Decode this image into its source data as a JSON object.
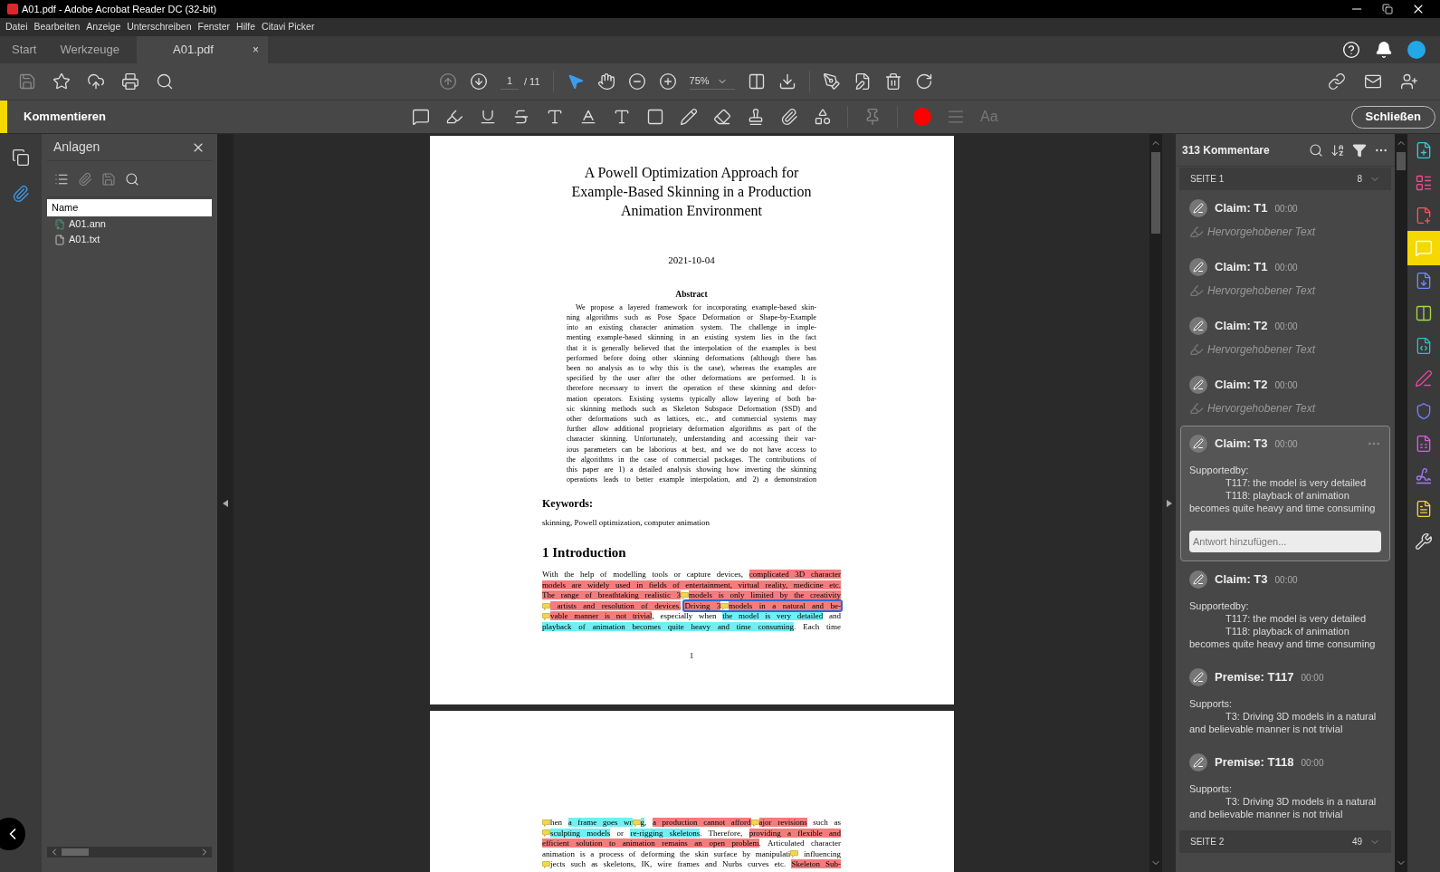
{
  "window": {
    "title": "A01.pdf - Adobe Acrobat Reader DC (32-bit)"
  },
  "menu": [
    "Datei",
    "Bearbeiten",
    "Anzeige",
    "Unterschreiben",
    "Fenster",
    "Hilfe",
    "Citavi Picker"
  ],
  "tabs": [
    {
      "label": "Start",
      "selected": false
    },
    {
      "label": "Werkzeuge",
      "selected": false
    },
    {
      "label": "A01.pdf",
      "selected": true,
      "close": "×"
    }
  ],
  "toolbar": {
    "page": "1",
    "page_total": "/ 11",
    "zoom": "75%"
  },
  "comment_bar": {
    "title": "Kommentieren",
    "close": "Schließen",
    "color": "#ff0000",
    "font": "Aa"
  },
  "attachments": {
    "title": "Anlagen",
    "column": "Name",
    "files": [
      {
        "name": "A01.ann",
        "kind": "ann"
      },
      {
        "name": "A01.txt",
        "kind": "txt"
      }
    ]
  },
  "document": {
    "title_lines": [
      "A Powell Optimization Approach for",
      "Example-Based Skinning in a Production",
      "Animation Environment"
    ],
    "date": "2021-10-04",
    "abstract_heading": "Abstract",
    "abstract_lines": [
      "We propose a layered framework for incorporating example-based skin-",
      "ning algorithms such as Pose Space Deformation or Shape-by-Example",
      "into an existing character animation system. The challenge in imple-",
      "menting example-based skinning in an existing system lies in the fact",
      "that it is generally believed that the interpolation of the examples is best",
      "performed before doing other skinning deformations (although there has",
      "been no analysis as to why this is the case), whereas the examples are",
      "specified by the user after the other deformations are performed. It is",
      "therefore necessary to invert the operation of these skinning and defor-",
      "mation operators. Existing systems typically allow layering of both ba-",
      "sic skinning methods such as Skeleton Subspace Deformation (SSD) and",
      "other deformations such as lattices, etc., and commercial systems may",
      "further allow additional proprietary deformation algorithms as part of the",
      "character skinning. Unfortunately, understanding and accessing their var-",
      "ious parameters can be laborious at best, and we do not have access to",
      "the algorithms in the case of commercial packages. The contributions of",
      "this paper are 1) a detailed analysis showing how inverting the skinning",
      "operations leads to better example interpolation, and 2) a demonstration"
    ],
    "keywords_heading": "Keywords:",
    "keywords": "skinning, Powell optimization, computer animation",
    "section": "1 Introduction",
    "intro_lines": [
      [
        {
          "kind": "text",
          "text": "With the help of modelling tools or capture devices, "
        },
        {
          "kind": "text",
          "text": "complicated 3D character",
          "color": "#f47c7c"
        }
      ],
      [
        {
          "kind": "text",
          "text": "models are widely used in fields of entertainment, virtual reality, medicine etc.",
          "color": "#f47c7c"
        }
      ],
      [
        {
          "kind": "text",
          "text": "The range of breathtaking realistic 3",
          "color": "#f47c7c"
        },
        {
          "kind": "note"
        },
        {
          "kind": "text",
          "text": "models is only limited by the creativity",
          "color": "#f47c7c"
        }
      ],
      [
        {
          "kind": "note"
        },
        {
          "kind": "text",
          "text": " artists and resolution of devices.",
          "color": "#f47c7c"
        },
        {
          "kind": "focus",
          "segments": [
            {
              "kind": "text",
              "text": "Driving 3",
              "color": "#f47c7c"
            },
            {
              "kind": "note"
            },
            {
              "kind": "text",
              "text": "models in a natural and be-",
              "color": "#f47c7c"
            }
          ]
        }
      ],
      [
        {
          "kind": "note"
        },
        {
          "kind": "text",
          "text": "vable manner is not trivial",
          "color": "#f47c7c"
        },
        {
          "kind": "text",
          "text": ", especially when "
        },
        {
          "kind": "text",
          "text": "the model is very detailed",
          "color": "#6ff0f2"
        },
        {
          "kind": "text",
          "text": " and"
        }
      ],
      [
        {
          "kind": "text",
          "text": "playback of animation becomes quite heavy and time consuming",
          "color": "#6ff0f2"
        },
        {
          "kind": "text",
          "text": ". Each time"
        }
      ]
    ],
    "page_number": "1",
    "page2_lines": [
      [
        {
          "kind": "note"
        },
        {
          "kind": "text",
          "text": "hen "
        },
        {
          "kind": "text",
          "text": "a frame goes wr",
          "color": "#6ff0f2"
        },
        {
          "kind": "note"
        },
        {
          "kind": "text",
          "text": "g",
          "color": "#6ff0f2"
        },
        {
          "kind": "text",
          "text": ", "
        },
        {
          "kind": "text",
          "text": "a production cannot afford",
          "color": "#f47c7c"
        },
        {
          "kind": "note"
        },
        {
          "kind": "text",
          "text": "ajor revisions",
          "color": "#f47c7c"
        },
        {
          "kind": "text",
          "text": " such as"
        }
      ],
      [
        {
          "kind": "note"
        },
        {
          "kind": "text",
          "text": "sculpting models",
          "color": "#6ff0f2"
        },
        {
          "kind": "text",
          "text": " or "
        },
        {
          "kind": "text",
          "text": "re-rigging skeletons",
          "color": "#6ff0f2"
        },
        {
          "kind": "text",
          "text": ". Therefore, "
        },
        {
          "kind": "text",
          "text": "providing a flexible and",
          "color": "#f47c7c"
        }
      ],
      [
        {
          "kind": "text",
          "text": "efficient solution to animation remains an open problem",
          "color": "#f47c7c"
        },
        {
          "kind": "text",
          "text": ". Articulated character"
        }
      ],
      [
        {
          "kind": "text",
          "text": "animation is a process of deforming the skin surface by manipulati"
        },
        {
          "kind": "note"
        },
        {
          "kind": "text",
          "text": " influencing"
        }
      ],
      [
        {
          "kind": "note"
        },
        {
          "kind": "text",
          "text": "jects such as skeletons, IK, wire frames and Nurbs curves etc. "
        },
        {
          "kind": "text",
          "text": "Skeleton Sub-",
          "color": "#f47c7c"
        }
      ]
    ]
  },
  "comments": {
    "count": "313 Kommentare",
    "groups": [
      {
        "label": "SEITE 1",
        "count": "8",
        "items": [
          {
            "kind": "highlight",
            "title": "Claim: T1",
            "time": "00:00",
            "text": "Hervorgehobener Text",
            "selected": false
          },
          {
            "kind": "highlight",
            "title": "Claim: T1",
            "time": "00:00",
            "text": "Hervorgehobener Text",
            "selected": false
          },
          {
            "kind": "highlight",
            "title": "Claim: T2",
            "time": "00:00",
            "text": "Hervorgehobener Text",
            "selected": false
          },
          {
            "kind": "highlight",
            "title": "Claim: T2",
            "time": "00:00",
            "text": "Hervorgehobener Text",
            "selected": false
          },
          {
            "kind": "note",
            "title": "Claim: T3",
            "time": "00:00",
            "label": "Supportedby:",
            "entries": [
              "T117: the model is very detailed",
              "T118: playback of animation becomes quite heavy and time consuming"
            ],
            "selected": true,
            "reply_placeholder": "Antwort hinzufügen..."
          },
          {
            "kind": "note",
            "title": "Claim: T3",
            "time": "00:00",
            "label": "Supportedby:",
            "entries": [
              "T117: the model is very detailed",
              "T118: playback of animation becomes quite heavy and time consuming"
            ],
            "selected": false
          },
          {
            "kind": "note",
            "title": "Premise: T117",
            "time": "00:00",
            "label": "Supports:",
            "entries": [
              "T3: Driving 3D models in a natural and believable manner is not trivial"
            ],
            "selected": false
          },
          {
            "kind": "note",
            "title": "Premise: T118",
            "time": "00:00",
            "label": "Supports:",
            "entries": [
              "T3: Driving 3D models in a natural and believable manner is not trivial"
            ],
            "selected": false
          }
        ]
      },
      {
        "label": "SEITE 2",
        "count": "49"
      }
    ]
  }
}
